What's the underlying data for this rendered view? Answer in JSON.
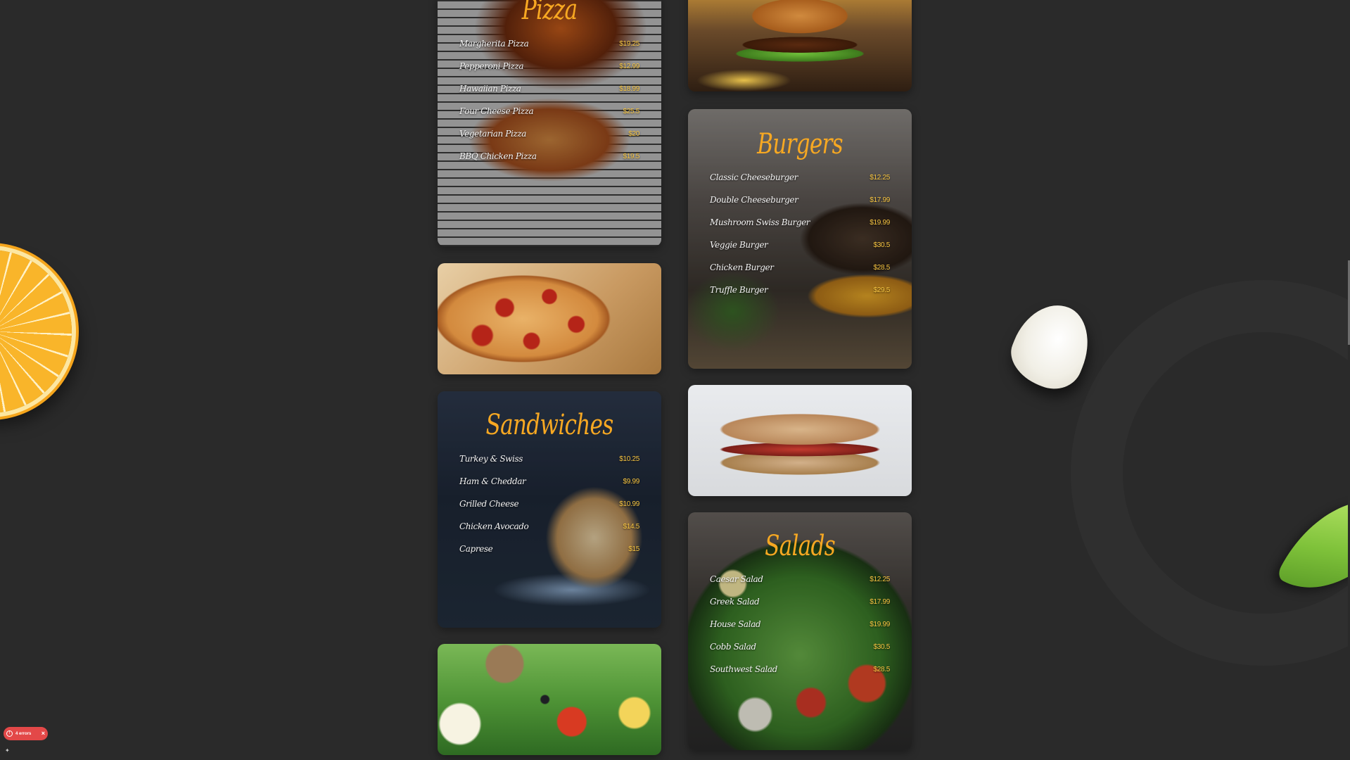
{
  "menus": [
    {
      "title": "Pizza",
      "items": [
        {
          "name": "Margherita Pizza",
          "price": "$19.25"
        },
        {
          "name": "Pepperoni Pizza",
          "price": "$12.99"
        },
        {
          "name": "Hawaiian Pizza",
          "price": "$18.99"
        },
        {
          "name": "Four Cheese Pizza",
          "price": "$25.5"
        },
        {
          "name": "Vegetarian Pizza",
          "price": "$20"
        },
        {
          "name": "BBQ Chicken Pizza",
          "price": "$19.5"
        }
      ]
    },
    {
      "title": "Burgers",
      "items": [
        {
          "name": "Classic Cheeseburger",
          "price": "$12.25"
        },
        {
          "name": "Double Cheeseburger",
          "price": "$17.99"
        },
        {
          "name": "Mushroom Swiss Burger",
          "price": "$19.99"
        },
        {
          "name": "Veggie Burger",
          "price": "$30.5"
        },
        {
          "name": "Chicken Burger",
          "price": "$28.5"
        },
        {
          "name": "Truffle Burger",
          "price": "$29.5"
        }
      ]
    },
    {
      "title": "Sandwiches",
      "items": [
        {
          "name": "Turkey & Swiss",
          "price": "$10.25"
        },
        {
          "name": "Ham & Cheddar",
          "price": "$9.99"
        },
        {
          "name": "Grilled Cheese",
          "price": "$10.99"
        },
        {
          "name": "Chicken Avocado",
          "price": "$14.5"
        },
        {
          "name": "Caprese",
          "price": "$15"
        }
      ]
    },
    {
      "title": "Salads",
      "items": [
        {
          "name": "Caesar Salad",
          "price": "$12.25"
        },
        {
          "name": "Greek Salad",
          "price": "$17.99"
        },
        {
          "name": "House Salad",
          "price": "$19.99"
        },
        {
          "name": "Cobb Salad",
          "price": "$30.5"
        },
        {
          "name": "Southwest Salad",
          "price": "$28.5"
        }
      ]
    }
  ],
  "error_badge": {
    "label": "4 errors",
    "icon": "alert-circle-icon",
    "close_icon": "close-icon",
    "color": "#e34848"
  },
  "colors": {
    "background": "#2a2a2a",
    "title_accent": "#f7a822",
    "price_accent": "#f7c542"
  }
}
